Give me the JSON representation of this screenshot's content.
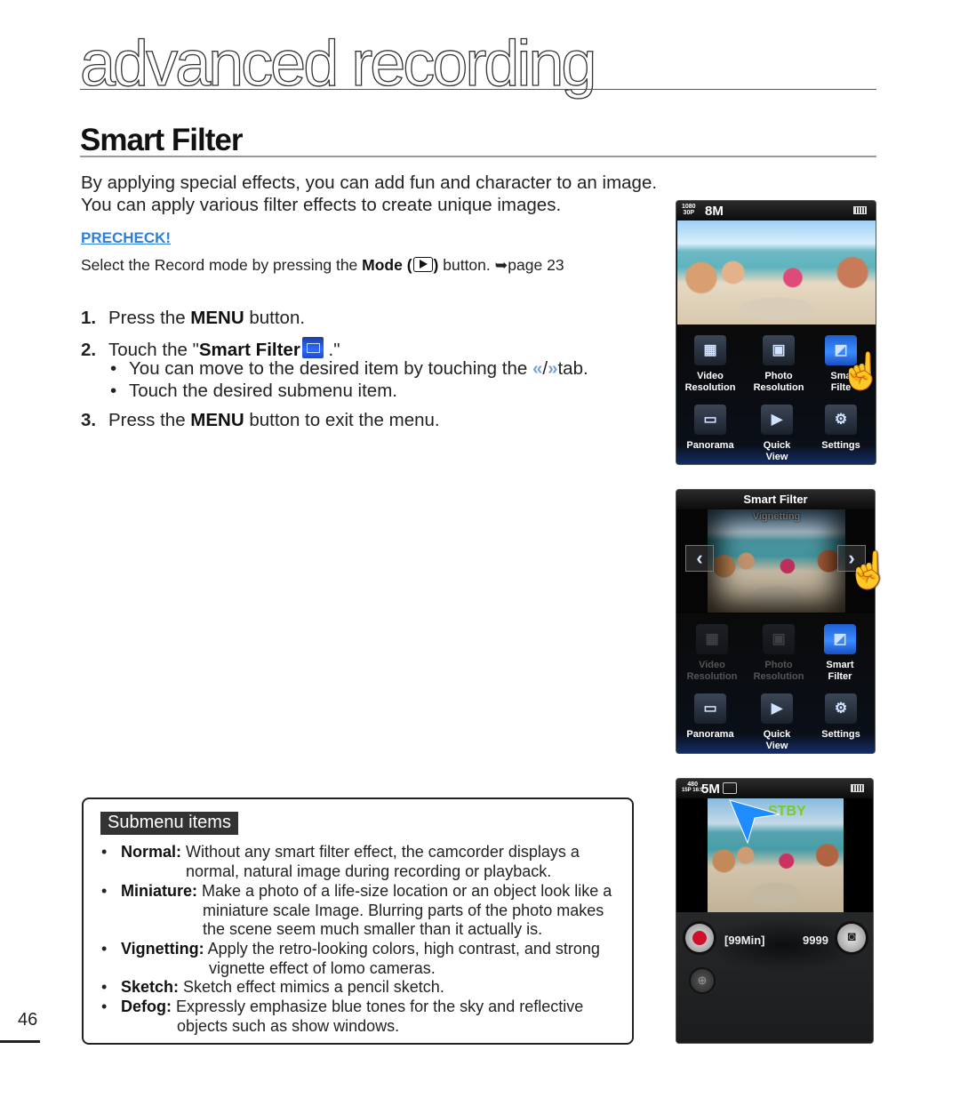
{
  "chapter_title": "advanced recording",
  "section_title": "Smart Filter",
  "intro": {
    "line1": "By applying special effects, you can add fun and character to an image.",
    "line2": "You can apply various filter effects to create unique images."
  },
  "precheck": {
    "label": "PRECHECK!",
    "text_before": "Select the Record mode by pressing the ",
    "mode_label": "Mode (",
    "mode_close": ")",
    "text_after": " button. ",
    "page_ref": "➥page 23"
  },
  "steps": [
    {
      "num": "1.",
      "before": "Press the ",
      "bold": "MENU",
      "after": " button."
    },
    {
      "num": "2.",
      "before": "Touch the \"",
      "bold": "Smart Filter",
      "after": " .\""
    },
    {
      "num": "3.",
      "before": "Press the ",
      "bold": "MENU",
      "after": " button to exit the menu."
    }
  ],
  "step2_subs": [
    {
      "before": "You can move to the desired item by touching the ",
      "left_tab": "«",
      "slash": "/",
      "right_tab": "»",
      "after": "tab."
    },
    {
      "text": "Touch the desired submenu item."
    }
  ],
  "screen1": {
    "quality_top": "1080",
    "quality_bottom": "30P",
    "resolution": "8M",
    "menu": [
      {
        "label1": "Video",
        "label2": "Resolution",
        "icon": "video-resolution-icon"
      },
      {
        "label1": "Photo",
        "label2": "Resolution",
        "icon": "photo-resolution-icon"
      },
      {
        "label1": "Sma",
        "label2": "Filte",
        "icon": "smart-filter-icon"
      },
      {
        "label1": "Panorama",
        "label2": "",
        "icon": "panorama-icon"
      },
      {
        "label1": "Quick",
        "label2": "View",
        "icon": "quick-view-icon"
      },
      {
        "label1": "Settings",
        "label2": "",
        "icon": "settings-icon"
      }
    ]
  },
  "screen2": {
    "title": "Smart Filter",
    "filter_name": "Vignetting",
    "menu": [
      {
        "label1": "Video",
        "label2": "Resolution",
        "icon": "video-resolution-icon"
      },
      {
        "label1": "Photo",
        "label2": "Resolution",
        "icon": "photo-resolution-icon"
      },
      {
        "label1": "Smart",
        "label2": "Filter",
        "icon": "smart-filter-icon"
      },
      {
        "label1": "Panorama",
        "label2": "",
        "icon": "panorama-icon"
      },
      {
        "label1": "Quick",
        "label2": "View",
        "icon": "quick-view-icon"
      },
      {
        "label1": "Settings",
        "label2": "",
        "icon": "settings-icon"
      }
    ]
  },
  "screen3": {
    "quality_top": "480",
    "quality_bottom": "15P 16:9",
    "resolution": "5M",
    "overlay_text": "STBY",
    "remaining_time": "[99Min]",
    "photo_count": "9999"
  },
  "submenu": {
    "title": "Submenu items",
    "items": [
      {
        "name": "Normal:",
        "line1": " Without any smart filter effect, the camcorder displays a",
        "line2": "normal, natural image during recording or playback."
      },
      {
        "name": "Miniature:",
        "line1": " Make a photo of a life-size location or an object look like a",
        "line2": "miniature scale Image. Blurring parts of the photo makes",
        "line3": "the scene seem much smaller than it actually is."
      },
      {
        "name": "Vignetting:",
        "line1": " Apply the retro-looking colors, high contrast, and strong",
        "line2": "vignette effect of lomo cameras."
      },
      {
        "name": "Sketch:",
        "line1": " Sketch effect mimics a pencil sketch."
      },
      {
        "name": "Defog:",
        "line1": " Expressly emphasize blue tones for the sky and reflective",
        "line2": "objects such as show windows."
      }
    ]
  },
  "page_number": "46",
  "colors": {
    "precheck": "#2a7fe0",
    "accent_blue": "#2d6cff",
    "record_red": "#d0102a"
  }
}
